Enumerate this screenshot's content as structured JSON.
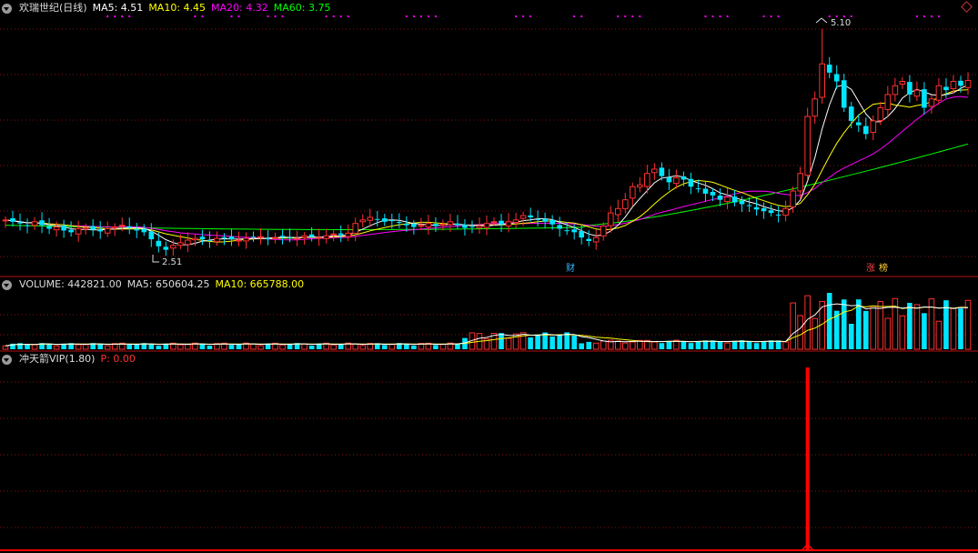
{
  "main_panel": {
    "title": "欢瑞世纪(日线)",
    "ma_labels": [
      {
        "text": "MA5: 4.51",
        "color": "#ffffff"
      },
      {
        "text": "MA10: 4.45",
        "color": "#ffff00"
      },
      {
        "text": "MA20: 4.32",
        "color": "#ff00ff"
      },
      {
        "text": "MA60: 3.75",
        "color": "#00ff00"
      }
    ],
    "high_label": "5.10",
    "low_label": "2.51",
    "event_tags": [
      {
        "text": "财",
        "color": "#3fb6ff"
      },
      {
        "text": "涨",
        "color": "#ff4040"
      },
      {
        "text": "榜",
        "color": "#ffcc33"
      }
    ]
  },
  "volume_panel": {
    "label": "VOLUME: 442821.00",
    "ma5_label": "MA5: 650604.25",
    "ma10_label": "MA10: 665788.00"
  },
  "indicator_panel": {
    "label": "冲天箭VIP(1.80)",
    "p_label": "P: 0.00"
  },
  "colors": {
    "up": "#ff3030",
    "down": "#00e5ff",
    "ma5": "#ffffff",
    "ma10": "#ffff00",
    "ma20": "#ff00ff",
    "ma60": "#00ff00",
    "grid": "#8a1010",
    "signal": "#ff0000"
  },
  "chart_data": {
    "type": "candlestick",
    "title": "欢瑞世纪(日线)",
    "price_range_visible": [
      2.51,
      5.1
    ],
    "close_approx": [
      2.92,
      2.9,
      2.88,
      2.85,
      2.9,
      2.86,
      2.82,
      2.84,
      2.8,
      2.78,
      2.82,
      2.83,
      2.81,
      2.79,
      2.82,
      2.84,
      2.86,
      2.83,
      2.8,
      2.78,
      2.7,
      2.62,
      2.58,
      2.63,
      2.66,
      2.69,
      2.71,
      2.7,
      2.69,
      2.71,
      2.72,
      2.7,
      2.69,
      2.71,
      2.72,
      2.73,
      2.71,
      2.72,
      2.73,
      2.72,
      2.71,
      2.74,
      2.73,
      2.72,
      2.74,
      2.76,
      2.75,
      2.77,
      2.88,
      2.92,
      2.95,
      2.93,
      2.9,
      2.91,
      2.89,
      2.86,
      2.84,
      2.86,
      2.88,
      2.85,
      2.87,
      2.9,
      2.86,
      2.83,
      2.84,
      2.85,
      2.88,
      2.9,
      2.87,
      2.9,
      2.92,
      2.97,
      2.95,
      2.93,
      2.9,
      2.87,
      2.82,
      2.8,
      2.78,
      2.72,
      2.68,
      2.72,
      2.85,
      3.0,
      3.05,
      3.15,
      3.3,
      3.32,
      3.45,
      3.5,
      3.42,
      3.35,
      3.4,
      3.38,
      3.3,
      3.28,
      3.22,
      3.2,
      3.15,
      3.18,
      3.12,
      3.1,
      3.08,
      3.04,
      3.02,
      3.0,
      2.98,
      3.05,
      3.25,
      3.45,
      4.1,
      4.3,
      4.7,
      4.6,
      4.5,
      4.2,
      4.05,
      4.0,
      3.9,
      4.05,
      4.2,
      4.35,
      4.45,
      4.5,
      4.35,
      4.4,
      4.2,
      4.3,
      4.45,
      4.4,
      4.5,
      4.45,
      4.51
    ],
    "ma_latest": {
      "MA5": 4.51,
      "MA10": 4.45,
      "MA20": 4.32,
      "MA60": 3.75
    },
    "volume": {
      "latest": 442821.0,
      "MA5": 650604.25,
      "MA10": 665788.0
    },
    "indicator": {
      "name": "冲天箭VIP",
      "param": 1.8,
      "P": 0.0,
      "signal_index": 110
    }
  }
}
